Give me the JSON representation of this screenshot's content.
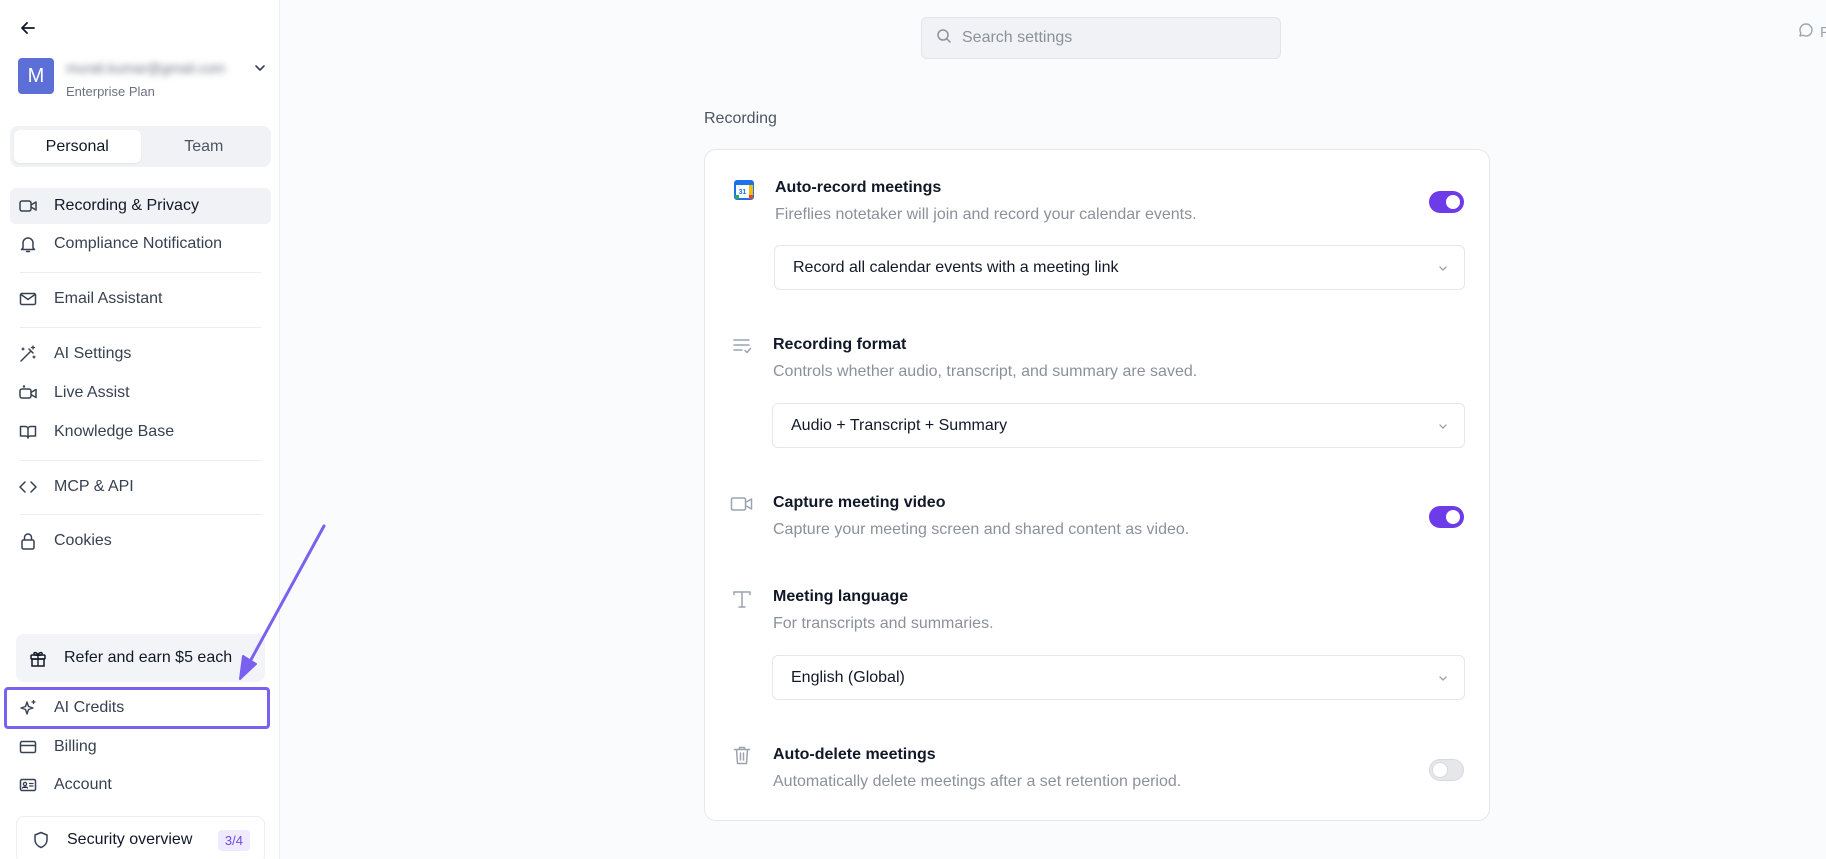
{
  "sidebar": {
    "account": {
      "initial": "M",
      "email": "murali.kumar@gmail.com",
      "plan": "Enterprise Plan"
    },
    "tabs": [
      {
        "label": "Personal",
        "active": true
      },
      {
        "label": "Team",
        "active": false
      }
    ],
    "items": [
      {
        "label": "Recording & Privacy",
        "icon": "video-icon"
      },
      {
        "label": "Compliance Notification",
        "icon": "bell-icon"
      },
      {
        "label": "Email Assistant",
        "icon": "mail-icon"
      },
      {
        "label": "AI Settings",
        "icon": "wand-icon"
      },
      {
        "label": "Live Assist",
        "icon": "live-video-icon"
      },
      {
        "label": "Knowledge Base",
        "icon": "book-icon"
      },
      {
        "label": "MCP & API",
        "icon": "code-icon"
      },
      {
        "label": "Cookies",
        "icon": "lock-icon"
      }
    ],
    "refer": {
      "label": "Refer and earn $5 each",
      "icon": "gift-icon"
    },
    "bottom_items": [
      {
        "label": "AI Credits",
        "icon": "sparkle-icon"
      },
      {
        "label": "Billing",
        "icon": "credit-card-icon"
      },
      {
        "label": "Account",
        "icon": "id-card-icon"
      }
    ],
    "security": {
      "label": "Security overview",
      "badge": "3/4"
    }
  },
  "search": {
    "placeholder": "Search settings"
  },
  "top_right": {
    "label": "F"
  },
  "main": {
    "section_title": "Recording",
    "rows": [
      {
        "title": "Auto-record meetings",
        "description": "Fireflies notetaker will join and record your calendar events.",
        "toggle": true,
        "select": "Record all calendar events with a meeting link",
        "icon": "google-calendar-icon"
      },
      {
        "title": "Recording format",
        "description": "Controls whether audio, transcript, and summary are saved.",
        "select": "Audio + Transcript + Summary",
        "icon": "list-check-icon"
      },
      {
        "title": "Capture meeting video",
        "description": "Capture your meeting screen and shared content as video.",
        "toggle": true,
        "icon": "video-icon"
      },
      {
        "title": "Meeting language",
        "description": "For transcripts and summaries.",
        "select": "English (Global)",
        "icon": "text-icon"
      },
      {
        "title": "Auto-delete meetings",
        "description": "Automatically delete meetings after a set retention period.",
        "toggle": false,
        "icon": "trash-icon"
      }
    ]
  },
  "colors": {
    "accent": "#6d3ce8",
    "annotation": "#7b61f0",
    "avatar": "#5b6fd6"
  }
}
